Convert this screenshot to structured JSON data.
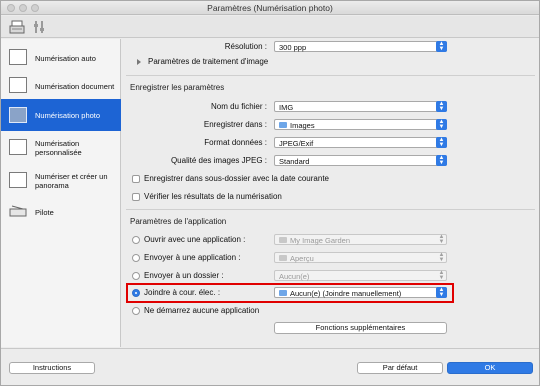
{
  "window": {
    "title": "Paramètres (Numérisation photo)"
  },
  "toolbar": {
    "icons": [
      "scan-settings-icon",
      "general-settings-icon"
    ]
  },
  "sidebar": {
    "items": [
      {
        "label": "Numérisation auto",
        "icon": "auto-scan-icon",
        "active": false
      },
      {
        "label": "Numérisation document",
        "icon": "document-scan-icon",
        "active": false
      },
      {
        "label": "Numérisation photo",
        "icon": "photo-scan-icon",
        "active": true
      },
      {
        "label": "Numérisation personnalisée",
        "icon": "custom-scan-icon",
        "active": false
      },
      {
        "label": "Numériser et créer un panorama",
        "icon": "panorama-icon",
        "active": false
      },
      {
        "label": "Pilote",
        "icon": "driver-icon",
        "active": false
      }
    ]
  },
  "scan": {
    "resolution_label": "Résolution :",
    "resolution_value": "300 ppp",
    "image_processing_label": "Paramètres de traitement d'image"
  },
  "save": {
    "section_title": "Enregistrer les paramètres",
    "filename_label": "Nom du fichier :",
    "filename_value": "IMG",
    "save_in_label": "Enregistrer dans :",
    "save_in_value": "Images",
    "format_label": "Format données :",
    "format_value": "JPEG/Exif",
    "jpeg_quality_label": "Qualité des images JPEG :",
    "jpeg_quality_value": "Standard",
    "subfolder_label": "Enregistrer dans sous-dossier avec la date courante",
    "verify_label": "Vérifier les résultats de la numérisation"
  },
  "app": {
    "section_title": "Paramètres de l'application",
    "options": [
      {
        "label": "Ouvrir avec une application :",
        "value": "My Image Garden",
        "selected": false
      },
      {
        "label": "Envoyer à une application :",
        "value": "Aperçu",
        "selected": false
      },
      {
        "label": "Envoyer à un dossier :",
        "value": "Aucun(e)",
        "selected": false
      },
      {
        "label": "Joindre à cour. élec. :",
        "value": "Aucun(e) (Joindre manuellement)",
        "selected": true
      },
      {
        "label": "Ne démarrez aucune application",
        "value": "",
        "selected": false
      }
    ],
    "more_functions_label": "Fonctions supplémentaires"
  },
  "footer": {
    "instructions_label": "Instructions",
    "defaults_label": "Par défaut",
    "ok_label": "OK"
  },
  "colors": {
    "accent": "#2f7ae5",
    "sidebar_active": "#1d64d4",
    "highlight": "#e00000"
  }
}
